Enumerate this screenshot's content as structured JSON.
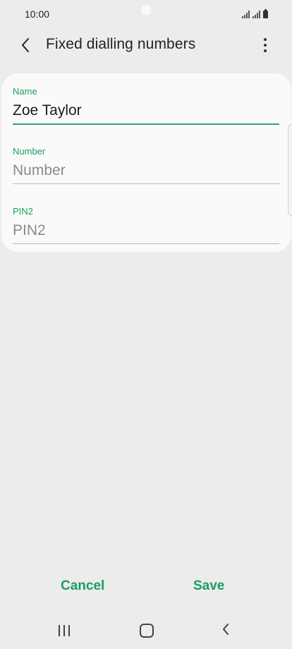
{
  "status_bar": {
    "time": "10:00"
  },
  "app_bar": {
    "title": "Fixed dialling numbers"
  },
  "form": {
    "name": {
      "label": "Name",
      "value": "Zoe Taylor"
    },
    "number": {
      "label": "Number",
      "placeholder": "Number"
    },
    "pin2": {
      "label": "PIN2",
      "placeholder": "PIN2"
    }
  },
  "actions": {
    "cancel": "Cancel",
    "save": "Save"
  },
  "colors": {
    "accent": "#1a9e5e",
    "background": "#ececec",
    "card": "#fafafa"
  },
  "icons": {
    "back": "chevron-left-icon",
    "more": "more-vertical-icon",
    "nav_recents": "recents-icon",
    "nav_home": "home-icon",
    "nav_back": "back-icon"
  }
}
